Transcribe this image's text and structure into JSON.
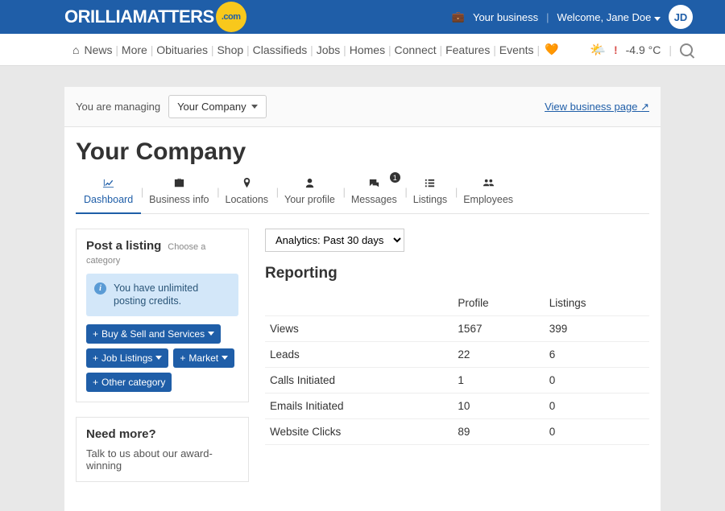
{
  "topbar": {
    "logo_main": "ORILLIAMATTERS",
    "logo_dot": ".com",
    "your_business": "Your business",
    "welcome": "Welcome, Jane Doe",
    "avatar": "JD"
  },
  "nav": {
    "items": [
      "News",
      "More",
      "Obituaries",
      "Shop",
      "Classifieds",
      "Jobs",
      "Homes",
      "Connect",
      "Features",
      "Events"
    ],
    "temp": "-4.9 °C"
  },
  "manage": {
    "label": "You are managing",
    "company": "Your Company",
    "view_link": "View business page"
  },
  "page_title": "Your Company",
  "tabs": [
    {
      "label": "Dashboard",
      "icon": "📈"
    },
    {
      "label": "Business info",
      "icon": "briefcase"
    },
    {
      "label": "Locations",
      "icon": "pin"
    },
    {
      "label": "Your profile",
      "icon": "person"
    },
    {
      "label": "Messages",
      "icon": "chat",
      "badge": "1"
    },
    {
      "label": "Listings",
      "icon": "list"
    },
    {
      "label": "Employees",
      "icon": "people"
    }
  ],
  "post": {
    "title": "Post a listing",
    "sub": "Choose a category",
    "info": "You have unlimited posting credits.",
    "buttons": [
      "Buy & Sell and Services",
      "Job Listings",
      "Market",
      "Other category"
    ]
  },
  "needmore": {
    "title": "Need more?",
    "text": "Talk to us about our award-winning"
  },
  "analytics_select": "Analytics: Past 30 days",
  "reporting": {
    "title": "Reporting",
    "cols": [
      "",
      "Profile",
      "Listings"
    ],
    "rows": [
      {
        "label": "Views",
        "profile": "1567",
        "listings": "399"
      },
      {
        "label": "Leads",
        "profile": "22",
        "listings": "6"
      },
      {
        "label": "Calls Initiated",
        "profile": "1",
        "listings": "0"
      },
      {
        "label": "Emails Initiated",
        "profile": "10",
        "listings": "0"
      },
      {
        "label": "Website Clicks",
        "profile": "89",
        "listings": "0"
      }
    ]
  }
}
